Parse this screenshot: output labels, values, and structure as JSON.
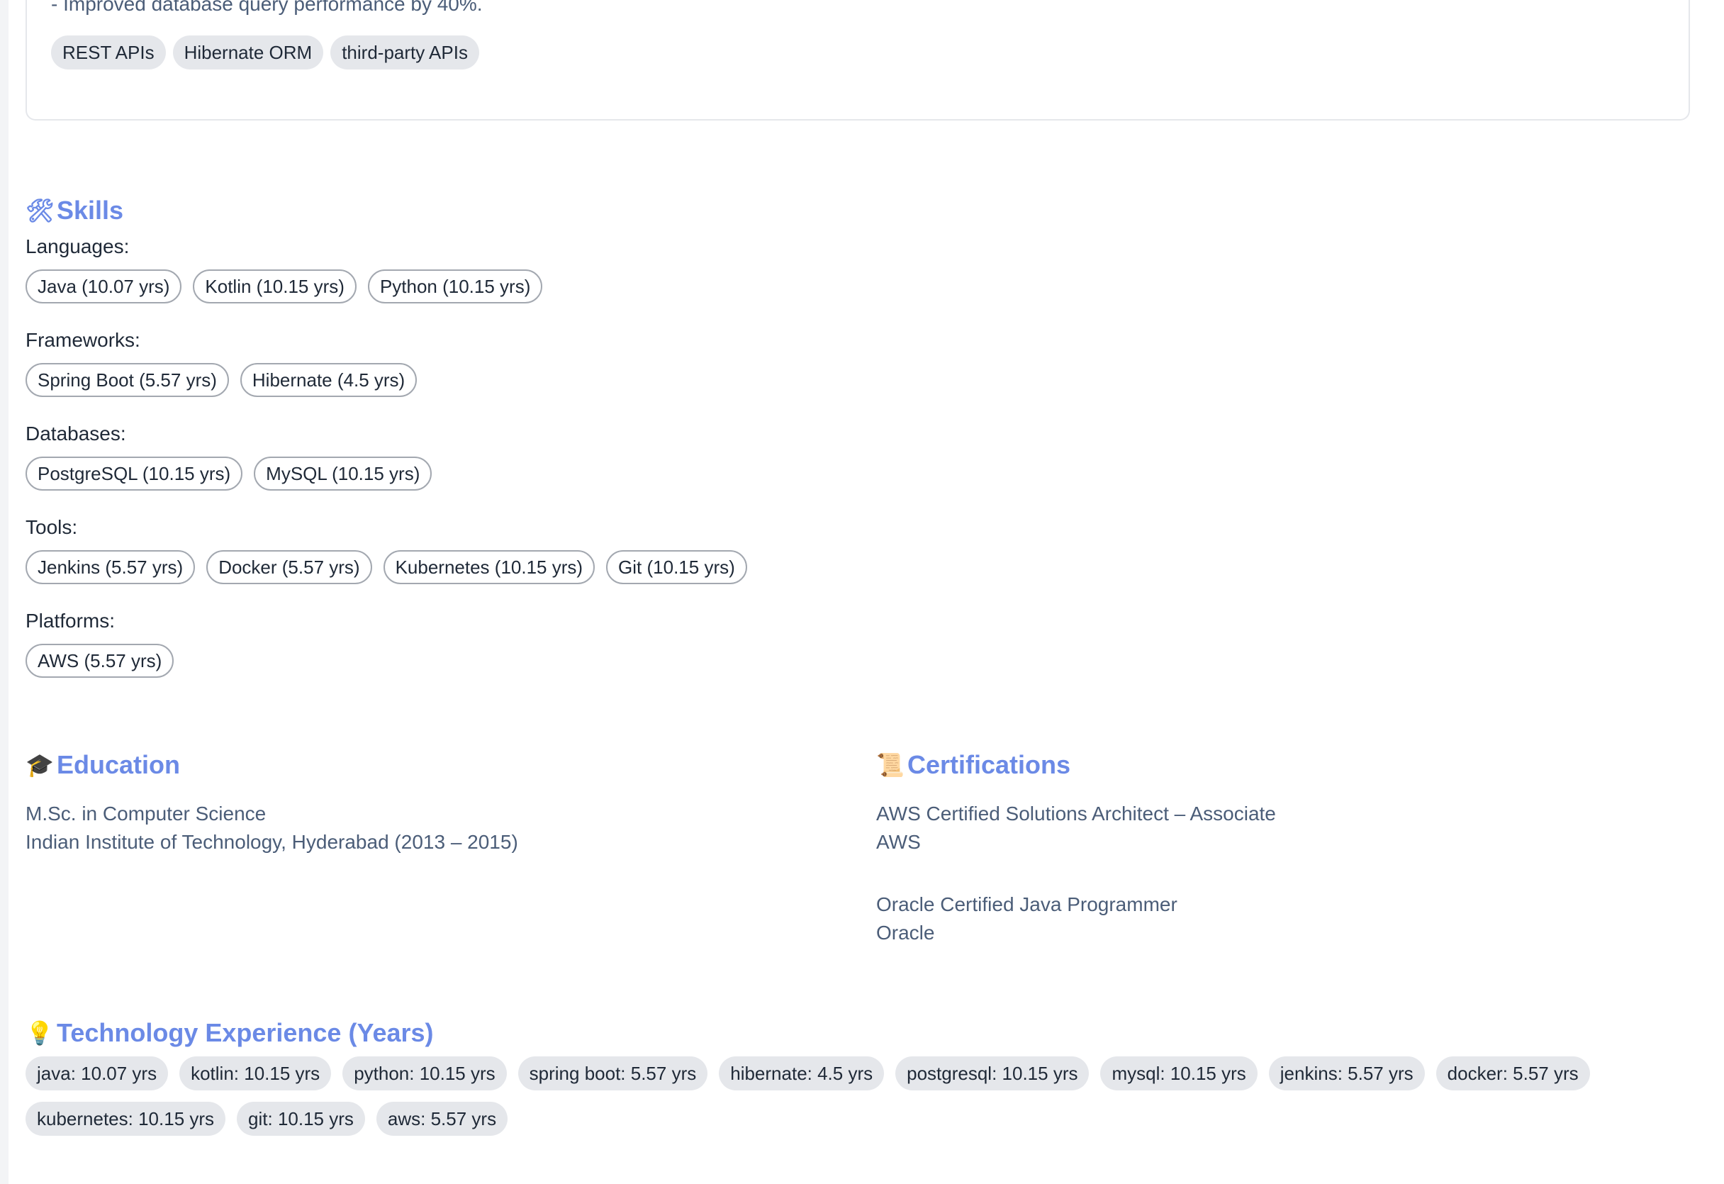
{
  "experience": {
    "bullet_last": "- Improved database query performance by 40%.",
    "tags": [
      "REST APIs",
      "Hibernate ORM",
      "third-party APIs"
    ]
  },
  "skills": {
    "icon": "hammer-and-wrench-icon",
    "title": "Skills",
    "categories": [
      {
        "label": "Languages:",
        "items": [
          "Java (10.07 yrs)",
          "Kotlin (10.15 yrs)",
          "Python (10.15 yrs)"
        ]
      },
      {
        "label": "Frameworks:",
        "items": [
          "Spring Boot (5.57 yrs)",
          "Hibernate (4.5 yrs)"
        ]
      },
      {
        "label": "Databases:",
        "items": [
          "PostgreSQL (10.15 yrs)",
          "MySQL (10.15 yrs)"
        ]
      },
      {
        "label": "Tools:",
        "items": [
          "Jenkins (5.57 yrs)",
          "Docker (5.57 yrs)",
          "Kubernetes (10.15 yrs)",
          "Git (10.15 yrs)"
        ]
      },
      {
        "label": "Platforms:",
        "items": [
          "AWS (5.57 yrs)"
        ]
      }
    ]
  },
  "education": {
    "icon": "graduation-cap-icon",
    "title": "Education",
    "degree": "M.Sc. in Computer Science",
    "school": "Indian Institute of Technology, Hyderabad (2013 – 2015)"
  },
  "certifications": {
    "icon": "scroll-icon",
    "title": "Certifications",
    "items": [
      {
        "name": "AWS Certified Solutions Architect – Associate",
        "issuer": "AWS"
      },
      {
        "name": "Oracle Certified Java Programmer",
        "issuer": "Oracle"
      }
    ]
  },
  "tech_experience": {
    "icon": "light-bulb-icon",
    "title": "Technology Experience (Years)",
    "items": [
      "java: 10.07 yrs",
      "kotlin: 10.15 yrs",
      "python: 10.15 yrs",
      "spring boot: 5.57 yrs",
      "hibernate: 4.5 yrs",
      "postgresql: 10.15 yrs",
      "mysql: 10.15 yrs",
      "jenkins: 5.57 yrs",
      "docker: 5.57 yrs",
      "kubernetes: 10.15 yrs",
      "git: 10.15 yrs",
      "aws: 5.57 yrs"
    ]
  },
  "colors": {
    "accent": "#6b8ae6",
    "muted_text": "#4b5d78",
    "chip_bg": "#e5e7eb"
  }
}
